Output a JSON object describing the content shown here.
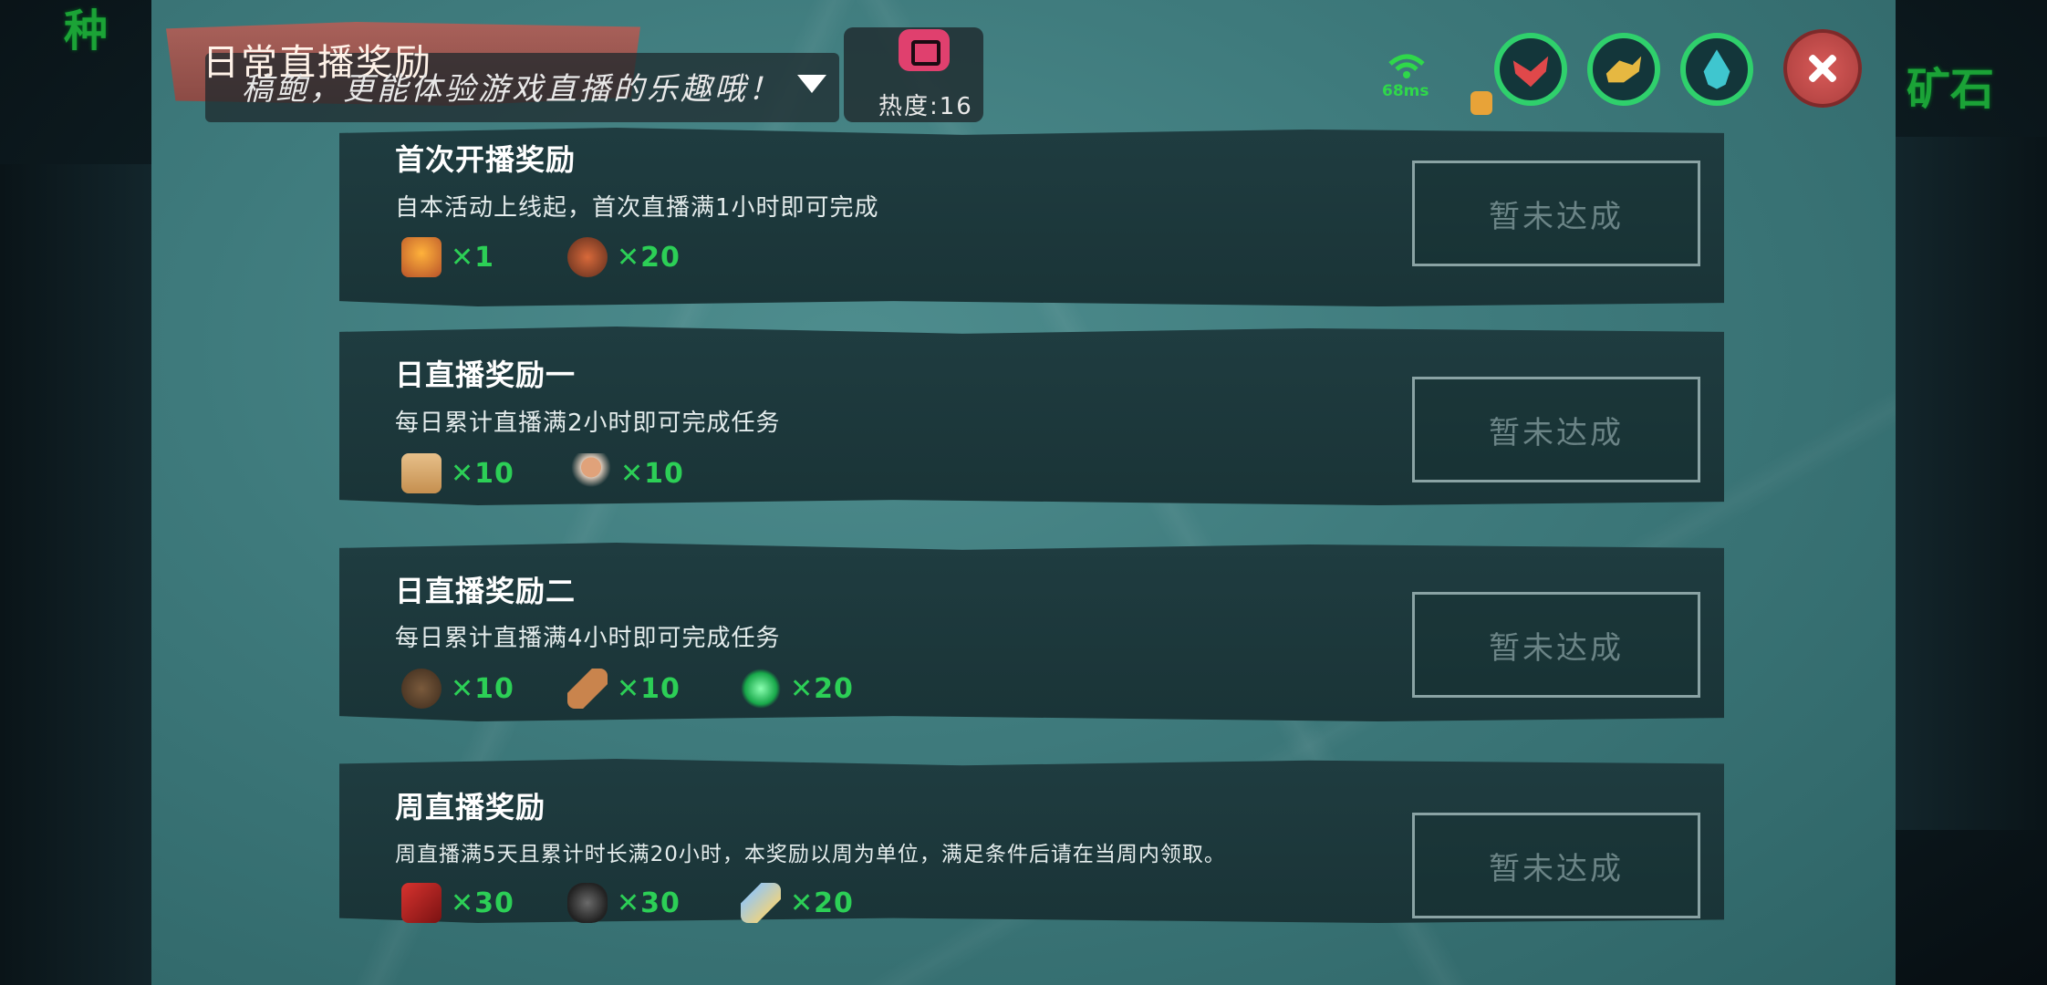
{
  "header": {
    "title": "日常直播奖励",
    "ticker": "稿鲍，更能体验游戏直播的乐趣哦！",
    "heat_label": "热度:16",
    "ping": "68ms"
  },
  "background": {
    "left_text": "种",
    "right_text": "矿石"
  },
  "rewards": [
    {
      "title": "首次开播奖励",
      "desc": "自本活动上线起，首次直播满1小时即可完成",
      "items": [
        {
          "icon": "campfire-icon",
          "qty": "✕1"
        },
        {
          "icon": "food-plate-icon",
          "qty": "✕20"
        }
      ],
      "status": "暂未达成"
    },
    {
      "title": "日直播奖励一",
      "desc": "每日累计直播满2小时即可完成任务",
      "items": [
        {
          "icon": "pet-food-bag-icon",
          "qty": "✕10"
        },
        {
          "icon": "lollipop-icon",
          "qty": "✕10"
        }
      ],
      "status": "暂未达成"
    },
    {
      "title": "日直播奖励二",
      "desc": "每日累计直播满4小时即可完成任务",
      "items": [
        {
          "icon": "ore-pile-icon",
          "qty": "✕10"
        },
        {
          "icon": "bread-icon",
          "qty": "✕10"
        },
        {
          "icon": "green-gem-icon",
          "qty": "✕20"
        }
      ],
      "status": "暂未达成"
    },
    {
      "title": "周直播奖励",
      "desc": "周直播满5天且累计时长满20小时，本奖励以周为单位，满足条件后请在当周内领取。",
      "items": [
        {
          "icon": "red-gift-icon",
          "qty": "✕30"
        },
        {
          "icon": "dark-ore-icon",
          "qty": "✕30"
        },
        {
          "icon": "fish-icon",
          "qty": "✕20"
        }
      ],
      "status": "暂未达成"
    }
  ],
  "colors": {
    "accent_green": "#2ccf56",
    "close_red": "#d85a58",
    "title_plank": "#a9615a"
  }
}
